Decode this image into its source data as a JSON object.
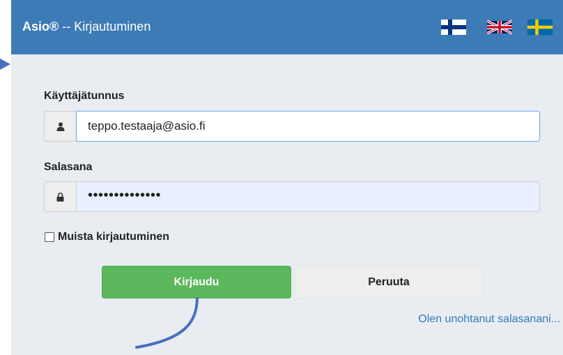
{
  "header": {
    "brand": "Asio®",
    "title_suffix": " -- Kirjautuminen",
    "flags": [
      "finnish-flag-icon",
      "uk-flag-icon",
      "swedish-flag-icon"
    ]
  },
  "form": {
    "username_label": "Käyttäjätunnus",
    "username_value": "teppo.testaaja@asio.fi",
    "password_label": "Salasana",
    "password_value": "••••••••••••••",
    "remember_label": "Muista kirjautuminen"
  },
  "buttons": {
    "login_label": "Kirjaudu",
    "cancel_label": "Peruuta"
  },
  "links": {
    "forgot_label": "Olen unohtanut salasanani..."
  },
  "colors": {
    "header": "#3d7bb6",
    "login": "#5cb85c",
    "link": "#337ab7",
    "annotation": "#4a6fbf"
  }
}
